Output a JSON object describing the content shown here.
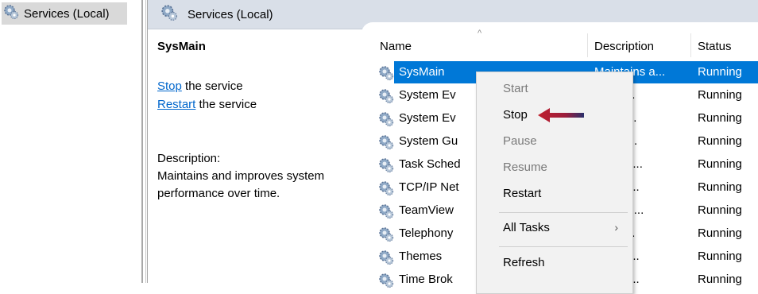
{
  "tree": {
    "item_label": "Services (Local)"
  },
  "header": {
    "title": "Services (Local)"
  },
  "detail": {
    "service_name": "SysMain",
    "stop_link": "Stop",
    "stop_suffix": " the service",
    "restart_link": "Restart",
    "restart_suffix": " the service",
    "description_label": "Description:",
    "description_line1": "Maintains and improves system",
    "description_line2": "performance over time."
  },
  "columns": {
    "name": "Name",
    "description": "Description",
    "status": "Status"
  },
  "rows": [
    {
      "name": "SysMain",
      "description": "Maintains a...",
      "status": "Running",
      "selected": true
    },
    {
      "name": "System Ev",
      "description": "ors sy...",
      "status": "Running"
    },
    {
      "name": "System Ev",
      "description": "nates ...",
      "status": "Running"
    },
    {
      "name": "System Gu",
      "description": "ors an...",
      "status": "Running"
    },
    {
      "name": "Task Sched",
      "description": "es a us...",
      "status": "Running"
    },
    {
      "name": "TCP/IP Net",
      "description": "es sup...",
      "status": "Running"
    },
    {
      "name": "TeamView",
      "description": "Viewer ...",
      "status": "Running"
    },
    {
      "name": "Telephony",
      "description": "es Tel...",
      "status": "Running"
    },
    {
      "name": "Themes",
      "description": "es use...",
      "status": "Running"
    },
    {
      "name": "Time Brok",
      "description": "inates ...",
      "status": "Running"
    }
  ],
  "context_menu": {
    "start": "Start",
    "stop": "Stop",
    "pause": "Pause",
    "resume": "Resume",
    "restart": "Restart",
    "all_tasks": "All Tasks",
    "refresh": "Refresh",
    "submenu_arrow": "›"
  },
  "colors": {
    "selection": "#0078d7",
    "link": "#0066cc",
    "annotation_arrow": "#c0202e"
  }
}
